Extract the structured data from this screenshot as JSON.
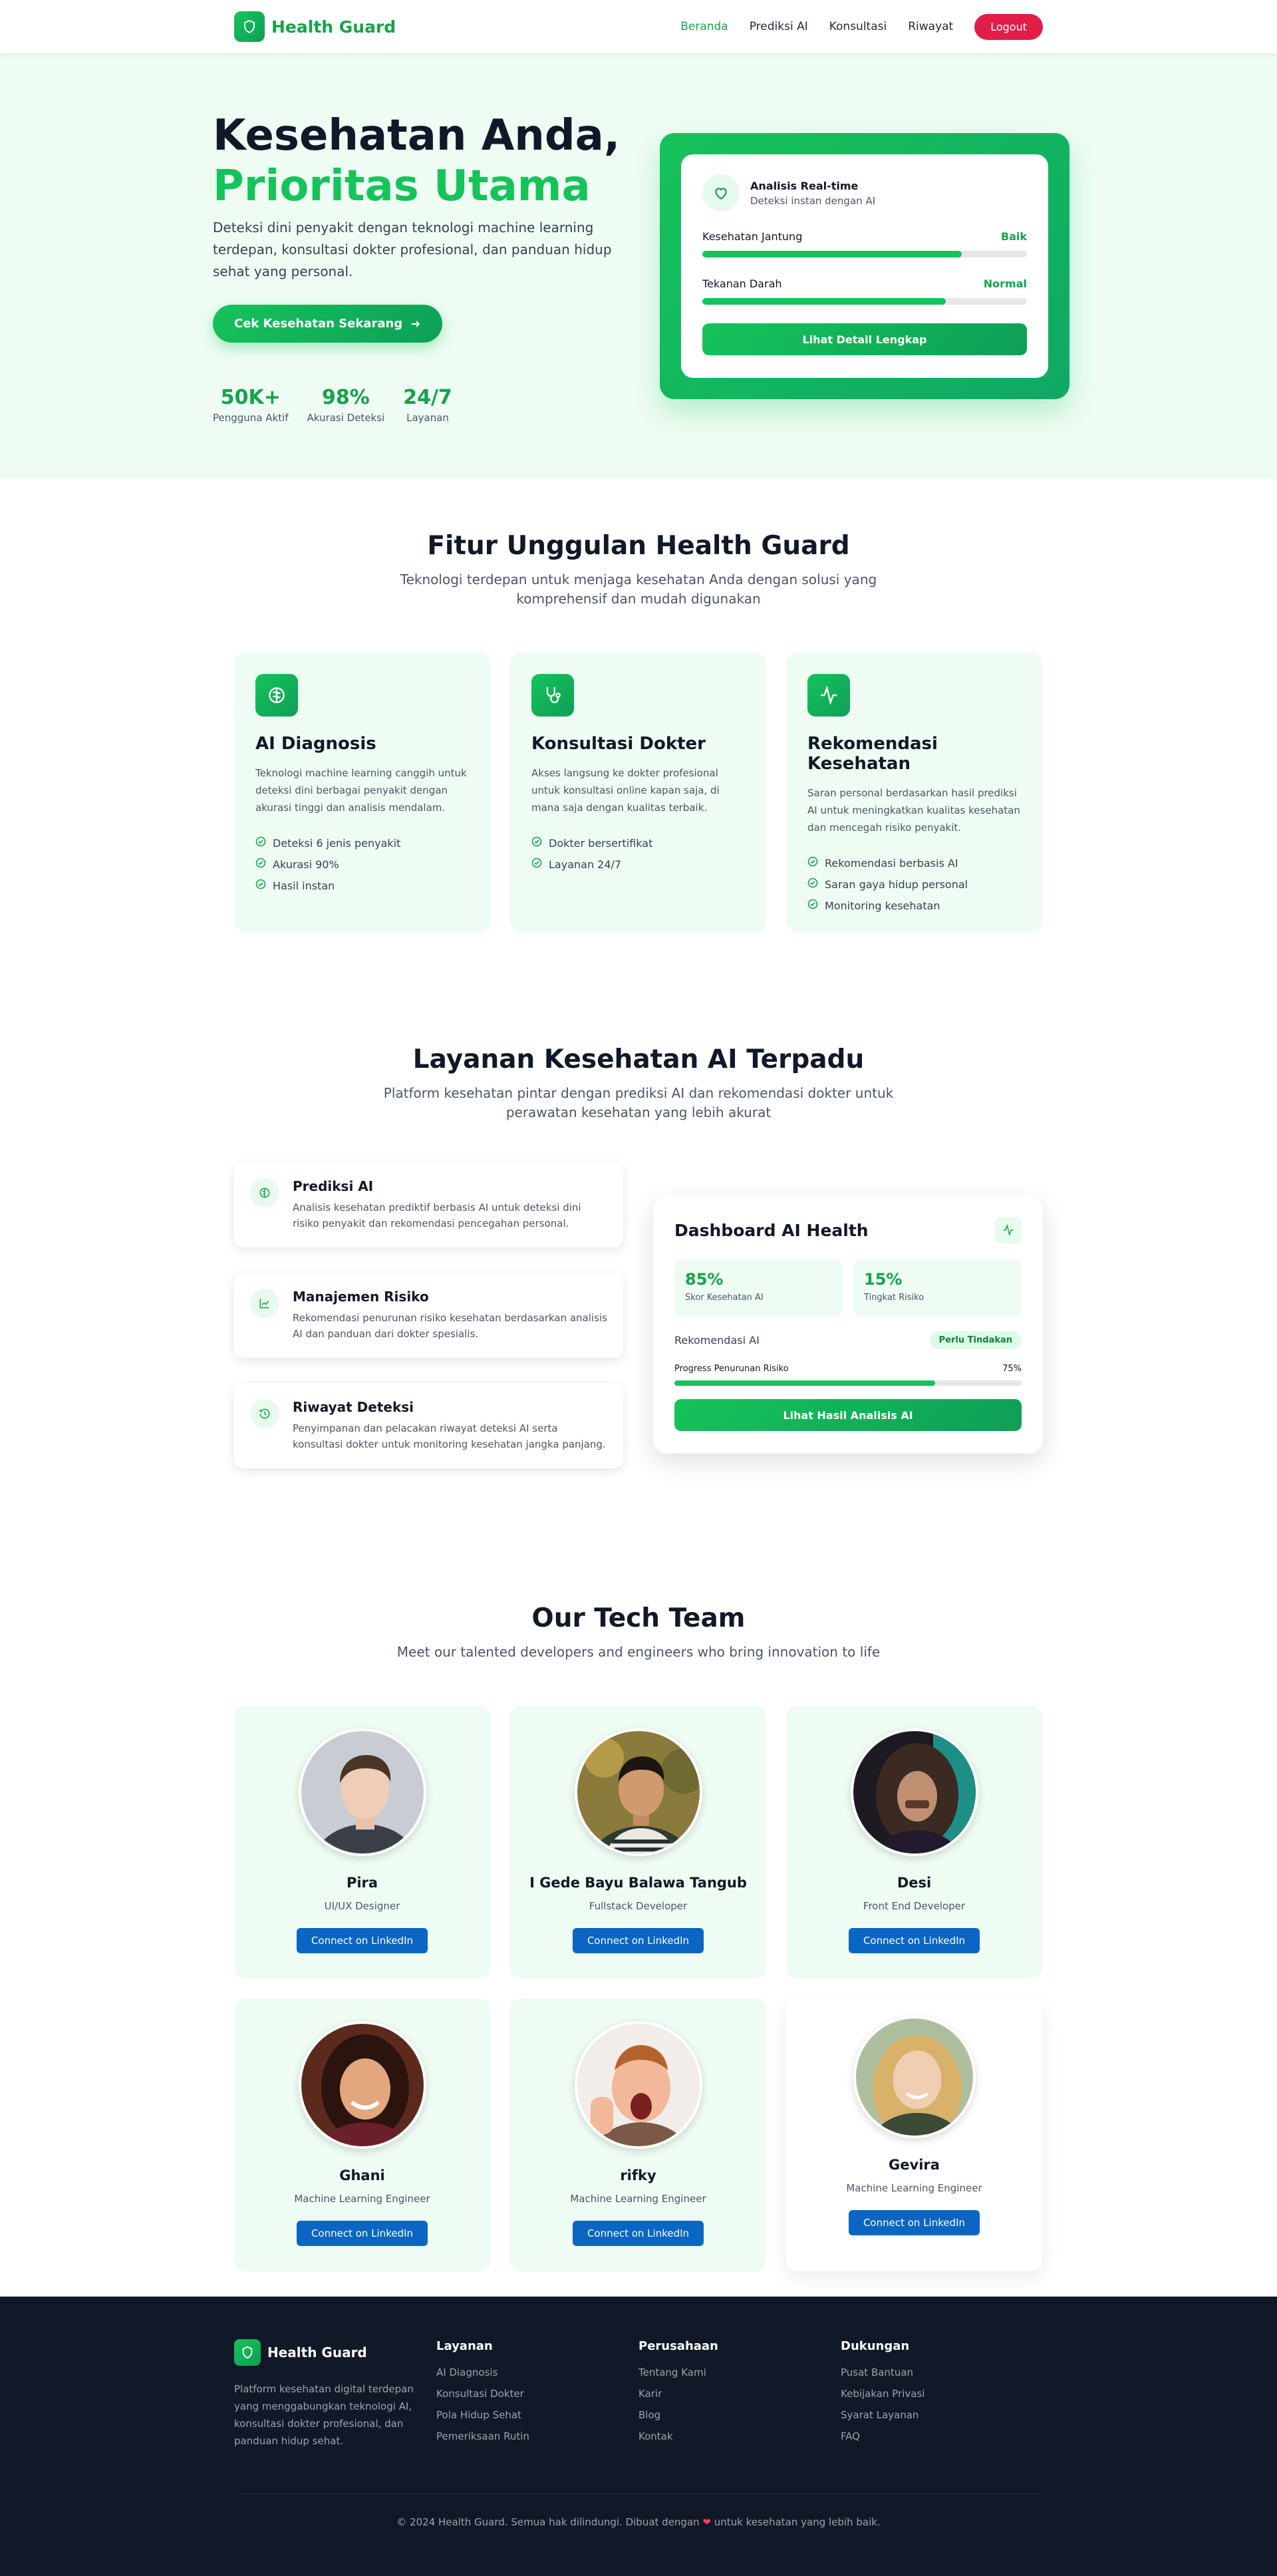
{
  "nav": {
    "brand": "Health Guard",
    "links": [
      {
        "label": "Beranda"
      },
      {
        "label": "Prediksi AI"
      },
      {
        "label": "Konsultasi"
      },
      {
        "label": "Riwayat"
      }
    ],
    "logout": "Logout"
  },
  "hero": {
    "title_line1": "Kesehatan Anda,",
    "title_line2": "Prioritas Utama",
    "description": "Deteksi dini penyakit dengan teknologi machine learning terdepan, konsultasi dokter profesional, dan panduan hidup sehat yang personal.",
    "cta": "Cek Kesehatan Sekarang",
    "stats": [
      {
        "value": "50K+",
        "label": "Pengguna Aktif"
      },
      {
        "value": "98%",
        "label": "Akurasi Deteksi"
      },
      {
        "value": "24/7",
        "label": "Layanan"
      }
    ],
    "card": {
      "title": "Analisis Real-time",
      "subtitle": "Deteksi instan dengan AI",
      "metrics": [
        {
          "label": "Kesehatan Jantung",
          "status": "Baik",
          "progress": 0.8
        },
        {
          "label": "Tekanan Darah",
          "status": "Normal",
          "progress": 0.75
        }
      ],
      "button": "Lihat Detail Lengkap"
    }
  },
  "features": {
    "title": "Fitur Unggulan Health Guard",
    "subtitle": "Teknologi terdepan untuk menjaga kesehatan Anda dengan solusi yang komprehensif dan mudah digunakan",
    "items": [
      {
        "icon": "brain-icon",
        "title": "AI Diagnosis",
        "description": "Teknologi machine learning canggih untuk deteksi dini berbagai penyakit dengan akurasi tinggi dan analisis mendalam.",
        "points": [
          "Deteksi 6 jenis penyakit",
          "Akurasi 90%",
          "Hasil instan"
        ]
      },
      {
        "icon": "stethoscope-icon",
        "title": "Konsultasi Dokter",
        "description": "Akses langsung ke dokter profesional untuk konsultasi online kapan saja, di mana saja dengan kualitas terbaik.",
        "points": [
          "Dokter bersertifikat",
          "Layanan 24/7"
        ]
      },
      {
        "icon": "activity-icon",
        "title": "Rekomendasi Kesehatan",
        "description": "Saran personal berdasarkan hasil prediksi AI untuk meningkatkan kualitas kesehatan dan mencegah risiko penyakit.",
        "points": [
          "Rekomendasi berbasis AI",
          "Saran gaya hidup personal",
          "Monitoring kesehatan"
        ]
      }
    ]
  },
  "layanan": {
    "title": "Layanan Kesehatan AI Terpadu",
    "subtitle": "Platform kesehatan pintar dengan prediksi AI dan rekomendasi dokter untuk perawatan kesehatan yang lebih akurat",
    "services": [
      {
        "icon": "brain-icon",
        "title": "Prediksi AI",
        "description": "Analisis kesehatan prediktif berbasis AI untuk deteksi dini risiko penyakit dan rekomendasi pencegahan personal."
      },
      {
        "icon": "chart-line-icon",
        "title": "Manajemen Risiko",
        "description": "Rekomendasi penurunan risiko kesehatan berdasarkan analisis AI dan panduan dari dokter spesialis."
      },
      {
        "icon": "history-icon",
        "title": "Riwayat Deteksi",
        "description": "Penyimpanan dan pelacakan riwayat deteksi AI serta konsultasi dokter untuk monitoring kesehatan jangka panjang."
      }
    ],
    "dashboard": {
      "title": "Dashboard AI Health",
      "stats": [
        {
          "value": "85%",
          "label": "Skor Kesehatan AI"
        },
        {
          "value": "15%",
          "label": "Tingkat Risiko"
        }
      ],
      "recommendation_label": "Rekomendasi AI",
      "recommendation_badge": "Perlu Tindakan",
      "progress_label": "Progress Penurunan Risiko",
      "progress_value": "75%",
      "progress": 0.75,
      "button": "Lihat Hasil Analisis AI"
    }
  },
  "team": {
    "title": "Our Tech Team",
    "subtitle": "Meet our talented developers and engineers who bring innovation to life",
    "button": "Connect on LinkedIn",
    "members": [
      {
        "name": "Pira",
        "role": "UI/UX Designer"
      },
      {
        "name": "I Gede Bayu Balawa Tangub",
        "role": "Fullstack Developer"
      },
      {
        "name": "Desi",
        "role": "Front End Developer"
      },
      {
        "name": "Ghani",
        "role": "Machine Learning Engineer"
      },
      {
        "name": "rifky",
        "role": "Machine Learning Engineer"
      },
      {
        "name": "Gevira",
        "role": "Machine Learning Engineer"
      }
    ]
  },
  "footer": {
    "brand": "Health Guard",
    "description": "Platform kesehatan digital terdepan yang menggabungkan teknologi AI, konsultasi dokter profesional, dan panduan hidup sehat.",
    "columns": [
      {
        "title": "Layanan",
        "links": [
          "AI Diagnosis",
          "Konsultasi Dokter",
          "Pola Hidup Sehat",
          "Pemeriksaan Rutin"
        ]
      },
      {
        "title": "Perusahaan",
        "links": [
          "Tentang Kami",
          "Karir",
          "Blog",
          "Kontak"
        ]
      },
      {
        "title": "Dukungan",
        "links": [
          "Pusat Bantuan",
          "Kebijakan Privasi",
          "Syarat Layanan",
          "FAQ"
        ]
      }
    ],
    "copyright_pre": "© 2024 Health Guard. Semua hak dilindungi. Dibuat dengan",
    "copyright_post": "untuk kesehatan yang lebih baik."
  },
  "colors": {
    "primary": "#16c35a",
    "primary_dark": "#0e9f57",
    "danger": "#e11d48",
    "linkedin": "#0a66c2",
    "footer_bg": "#111827"
  }
}
